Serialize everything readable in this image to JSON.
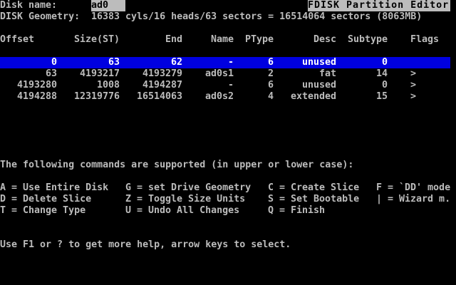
{
  "header": {
    "disk_name_label": "Disk name:",
    "disk_name_value": "ad0",
    "title": "FDISK Partition Editor",
    "geometry_label": "DISK Geometry:",
    "geometry_value": "16383 cyls/16 heads/63 sectors = 16514064 sectors (8063MB)"
  },
  "table": {
    "headers": [
      "Offset",
      "Size(ST)",
      "End",
      "Name",
      "PType",
      "Desc",
      "Subtype",
      "Flags"
    ],
    "rows": [
      {
        "offset": "0",
        "size": "63",
        "end": "62",
        "name": "-",
        "ptype": "6",
        "desc": "unused",
        "subtype": "0",
        "flags": "",
        "selected": true
      },
      {
        "offset": "63",
        "size": "4193217",
        "end": "4193279",
        "name": "ad0s1",
        "ptype": "2",
        "desc": "fat",
        "subtype": "14",
        "flags": ">",
        "selected": false
      },
      {
        "offset": "4193280",
        "size": "1008",
        "end": "4194287",
        "name": "-",
        "ptype": "6",
        "desc": "unused",
        "subtype": "0",
        "flags": ">",
        "selected": false
      },
      {
        "offset": "4194288",
        "size": "12319776",
        "end": "16514063",
        "name": "ad0s2",
        "ptype": "4",
        "desc": "extended",
        "subtype": "15",
        "flags": ">",
        "selected": false
      }
    ]
  },
  "commands": {
    "intro": "The following commands are supported (in upper or lower case):",
    "items": [
      "A = Use Entire Disk",
      "G = set Drive Geometry",
      "C = Create Slice",
      "F = `DD' mode",
      "D = Delete Slice",
      "Z = Toggle Size Units",
      "S = Set Bootable",
      "| = Wizard m.",
      "T = Change Type",
      "U = Undo All Changes",
      "Q = Finish"
    ]
  },
  "footer": {
    "help": "Use F1 or ? to get more help, arrow keys to select."
  },
  "colors": {
    "background": "#000000",
    "text": "#bcbcbc",
    "reverse_bg": "#bcbcbc",
    "selection_bg": "#0000e0",
    "selection_text": "#ffffff"
  }
}
